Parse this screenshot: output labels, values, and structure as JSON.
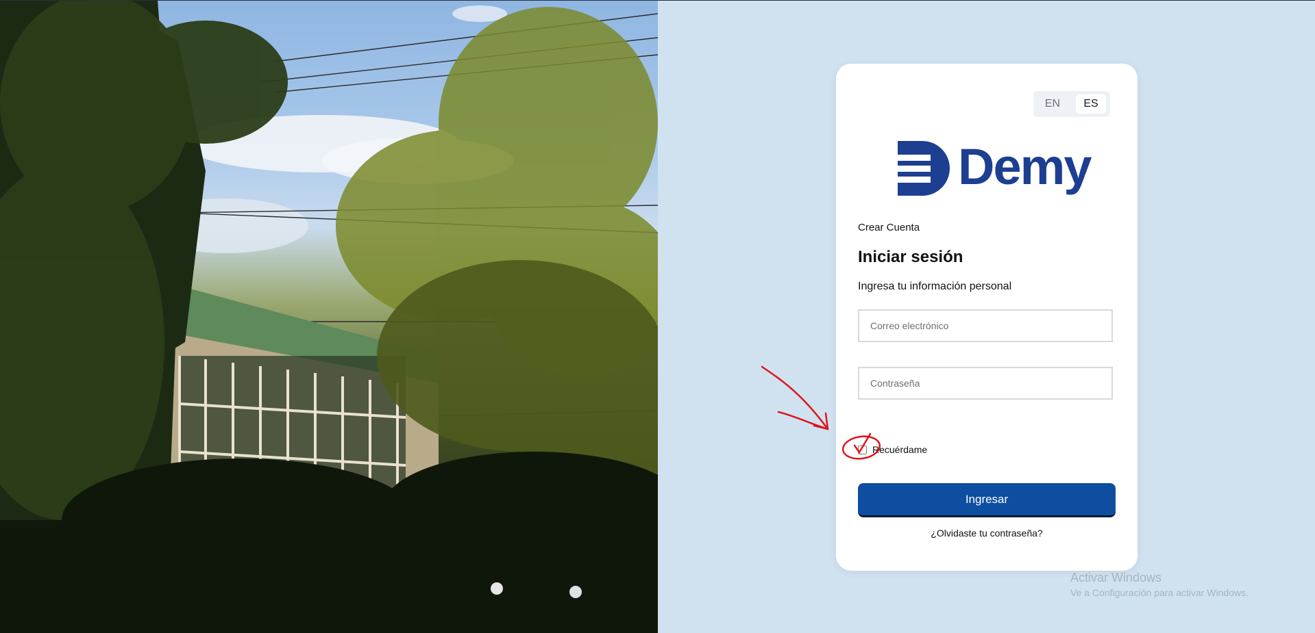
{
  "language_switch": {
    "options": [
      "EN",
      "ES"
    ],
    "selected": "ES"
  },
  "logo": {
    "text": "Demy",
    "brand_color": "#1d3f92"
  },
  "create_account_link": "Crear Cuenta",
  "login": {
    "title": "Iniciar sesión",
    "subtitle": "Ingresa tu información personal",
    "email_placeholder": "Correo electrónico",
    "password_placeholder": "Contraseña",
    "remember_label": "Recuérdame",
    "remember_checked": false,
    "submit_label": "Ingresar",
    "forgot_password": "¿Olvidaste tu contraseña?"
  },
  "colors": {
    "page_background": "#d0e2f0",
    "primary_button": "#0e4ea0",
    "annotation": "#e0141b"
  },
  "windows_watermark": {
    "title": "Activar Windows",
    "subtitle": "Ve a Configuración para activar Windows."
  },
  "background_photo": {
    "subject": "building surrounded by tall trees"
  }
}
